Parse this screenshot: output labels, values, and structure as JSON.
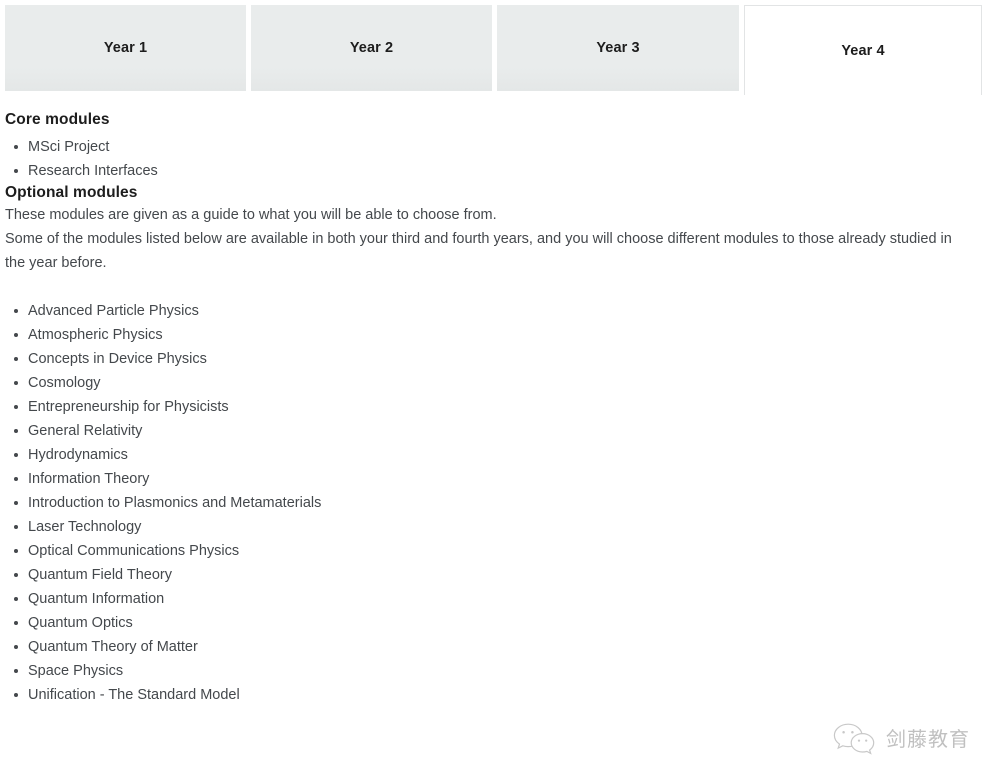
{
  "tabs": [
    {
      "label": "Year 1",
      "active": false
    },
    {
      "label": "Year 2",
      "active": false
    },
    {
      "label": "Year 3",
      "active": false
    },
    {
      "label": "Year 4",
      "active": true
    }
  ],
  "core": {
    "heading": "Core modules",
    "modules": [
      "MSci Project",
      "Research Interfaces"
    ]
  },
  "optional": {
    "heading": "Optional modules",
    "paragraph_1": "These modules are given as a guide to what you will be able to choose from.",
    "paragraph_2": "Some of the modules listed below are available in both your third and fourth years, and you will choose different modules to those already studied in the year before.",
    "modules": [
      "Advanced Particle Physics",
      "Atmospheric Physics",
      "Concepts in Device Physics",
      "Cosmology",
      "Entrepreneurship for Physicists",
      "General Relativity",
      "Hydrodynamics",
      "Information Theory",
      "Introduction to Plasmonics and Metamaterials",
      "Laser Technology",
      "Optical Communications Physics",
      "Quantum Field Theory",
      "Quantum Information",
      "Quantum Optics",
      "Quantum Theory of Matter",
      "Space Physics",
      "Unification - The Standard Model"
    ]
  },
  "watermark": {
    "icon": "wechat-icon",
    "text": "剑藤教育"
  },
  "colors": {
    "page_background": "#ffffff",
    "tab_inactive_background": "#e9ecec",
    "tab_active_background": "#ffffff",
    "tab_active_border": "#e2e4e5",
    "heading_text": "#1d1d1d",
    "body_text": "#44484c",
    "watermark_text": "#9a9a9a"
  }
}
